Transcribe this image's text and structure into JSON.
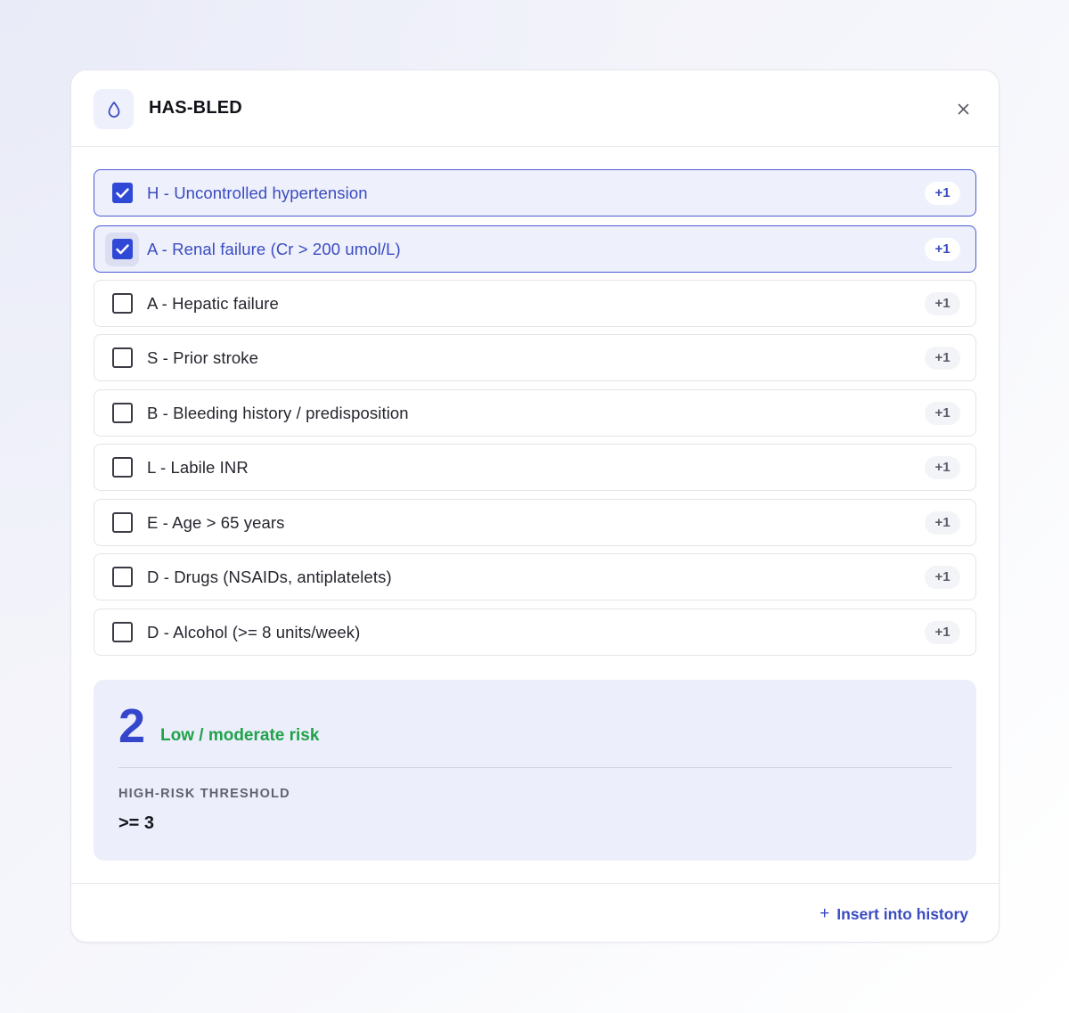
{
  "header": {
    "title": "HAS-BLED",
    "icon": "droplet-icon",
    "close_icon": "close-icon"
  },
  "criteria": [
    {
      "label": "H - Uncontrolled hypertension",
      "points": "+1",
      "checked": true
    },
    {
      "label": "A - Renal failure (Cr > 200 umol/L)",
      "points": "+1",
      "checked": true
    },
    {
      "label": "A - Hepatic failure",
      "points": "+1",
      "checked": false
    },
    {
      "label": "S - Prior stroke",
      "points": "+1",
      "checked": false
    },
    {
      "label": "B - Bleeding history / predisposition",
      "points": "+1",
      "checked": false
    },
    {
      "label": "L - Labile INR",
      "points": "+1",
      "checked": false
    },
    {
      "label": "E - Age > 65 years",
      "points": "+1",
      "checked": false
    },
    {
      "label": "D - Drugs (NSAIDs, antiplatelets)",
      "points": "+1",
      "checked": false
    },
    {
      "label": "D - Alcohol (>= 8 units/week)",
      "points": "+1",
      "checked": false
    }
  ],
  "result": {
    "score": "2",
    "risk_label": "Low / moderate risk",
    "threshold_label": "HIGH-RISK THRESHOLD",
    "threshold_value": ">= 3"
  },
  "footer": {
    "insert_label": "Insert into history",
    "insert_icon": "plus-icon"
  },
  "colors": {
    "accent": "#3447cc",
    "checked_bg": "#eef0fc",
    "risk_green": "#1fa34a",
    "result_bg": "#eceefb"
  }
}
